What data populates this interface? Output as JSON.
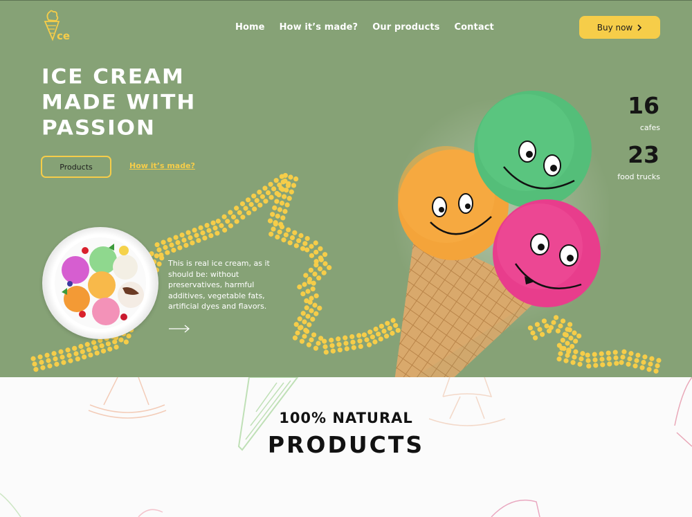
{
  "header": {
    "logo_text": "ce",
    "nav": [
      {
        "label": "Home"
      },
      {
        "label": "How it’s made?"
      },
      {
        "label": "Our products"
      },
      {
        "label": "Contact"
      }
    ],
    "buy_label": "Buy now",
    "buy_icon": "chevron-right-icon"
  },
  "hero": {
    "headline": [
      "ICE CREAM",
      "MADE WITH",
      "PASSION"
    ],
    "products_button": "Products",
    "how_link": "How it’s made?",
    "description": "This is real ice cream, as it should be: without preservatives, harmful additives, vegetable fats, artificial dyes and flavors.",
    "arrow_icon": "arrow-right-icon",
    "stats": [
      {
        "value": "16",
        "label": "cafes"
      },
      {
        "value": "23",
        "label": "food trucks"
      }
    ]
  },
  "section": {
    "subtitle": "100% NATURAL",
    "title": "PRODUCTS"
  },
  "colors": {
    "hero_bg": "#86a276",
    "accent": "#f6cd49",
    "dark": "#151515"
  }
}
